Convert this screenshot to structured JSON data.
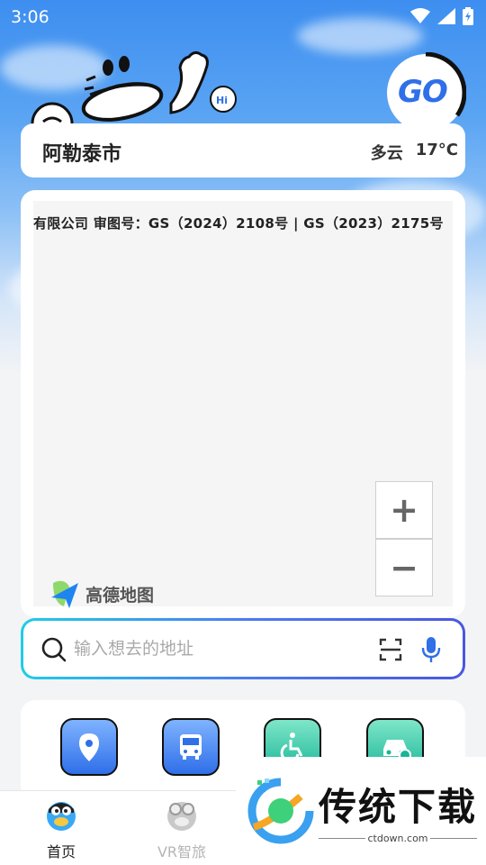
{
  "status_bar": {
    "time": "3:06"
  },
  "header": {
    "go_label": "GO"
  },
  "location": {
    "city": "阿勒泰市",
    "condition": "多云",
    "temperature": "17°C"
  },
  "map": {
    "copyright": "有限公司 审图号：GS（2024）2108号 | GS（2023）2175号",
    "logo_text": "高德地图",
    "zoom_in_label": "+",
    "zoom_out_label": "−"
  },
  "search": {
    "placeholder": "输入想去的地址"
  },
  "quick_actions": [
    {
      "icon": "location-pin-icon"
    },
    {
      "icon": "bus-icon"
    },
    {
      "icon": "wheelchair-icon"
    },
    {
      "icon": "car-icon"
    }
  ],
  "tabs": [
    {
      "label": "首页",
      "active": true
    },
    {
      "label": "VR智旅",
      "active": false
    }
  ],
  "watermark": {
    "title": "传统下载",
    "url": "ctdown.com"
  },
  "colors": {
    "accent": "#2f6fe8",
    "tab_inactive": "#b5b5b5",
    "tab_active": "#222222"
  }
}
